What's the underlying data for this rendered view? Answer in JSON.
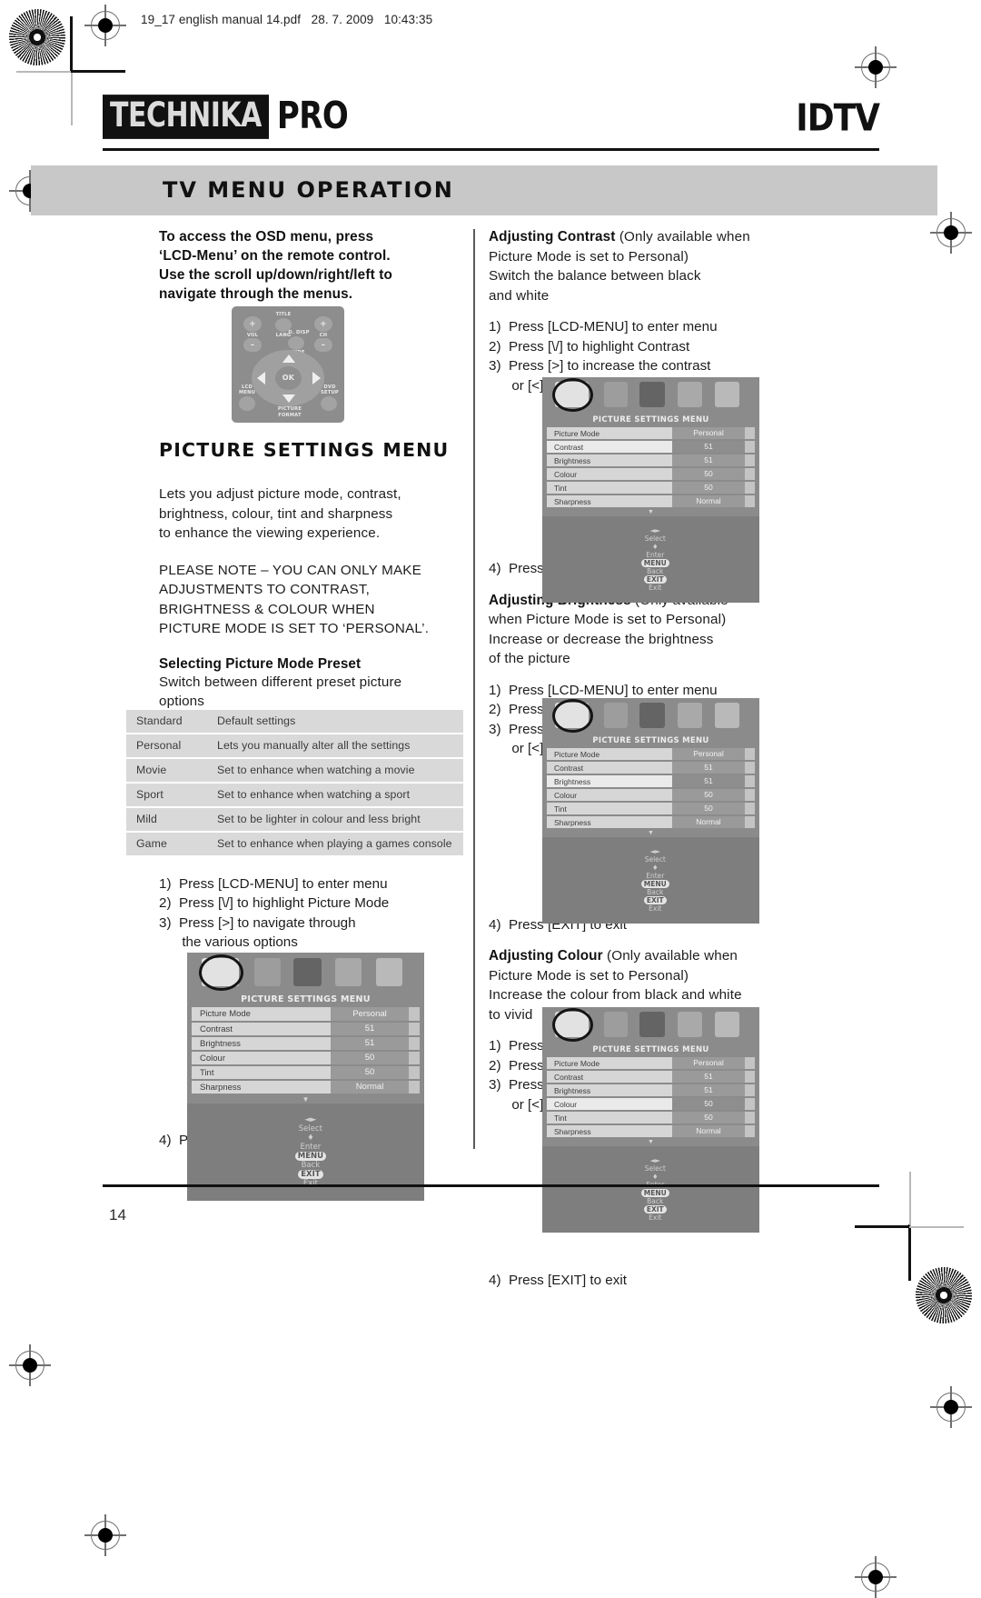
{
  "print": {
    "file_caption": "19_17 english manual 14.pdf   28. 7. 2009   10:43:35"
  },
  "header": {
    "logo_box": "TECHNIKA",
    "logo_pro": "PRO",
    "product": "IDTV",
    "section_title": "TV MENU OPERATION"
  },
  "left_column": {
    "intro": "To access the OSD menu, press ‘LCD-Menu’ on the remote control. Use the scroll up/down/right/left to navigate through the menus.",
    "intro_lines": [
      "To access the OSD menu, press",
      "‘LCD-Menu’ on the remote control.",
      "Use the scroll up/down/right/left to",
      "navigate through the menus."
    ],
    "remote": {
      "labels": {
        "title": "TITLE",
        "lang": "LANG",
        "d_disp": "D. DISP",
        "guide": "GUIDE",
        "vol": "VOL",
        "ch": "CH",
        "ok": "OK",
        "vol_plus": "+",
        "vol_minus": "–",
        "ch_plus": "+",
        "ch_minus": "–",
        "lcd_menu": "LCD\nMENU",
        "dvd_setup": "DVD\nSETUP",
        "picture_format": "PICTURE\nFORMAT"
      }
    },
    "heading": "PICTURE SETTINGS MENU",
    "desc_lines": [
      "Lets you adjust picture mode, contrast,",
      "brightness, colour, tint and sharpness",
      "to enhance the viewing experience."
    ],
    "note_lines": [
      "PLEASE NOTE – YOU CAN ONLY MAKE",
      "ADJUSTMENTS TO CONTRAST,",
      "BRIGHTNESS & COLOUR WHEN",
      "PICTURE MODE IS SET TO ‘PERSONAL’."
    ],
    "preset": {
      "subheading": "Selecting Picture Mode Preset",
      "desc_lines": [
        "Switch between different preset picture",
        "options"
      ],
      "rows": [
        {
          "mode": "Standard",
          "description": "Default settings"
        },
        {
          "mode": "Personal",
          "description": "Lets you manually alter all the settings"
        },
        {
          "mode": "Movie",
          "description": "Set to enhance when watching a movie"
        },
        {
          "mode": "Sport",
          "description": "Set to enhance when watching a sport"
        },
        {
          "mode": "Mild",
          "description": "Set to be lighter in colour and less bright"
        },
        {
          "mode": "Game",
          "description": "Set to enhance when playing a games console"
        }
      ],
      "steps": [
        "1)  Press [LCD-MENU] to enter menu",
        "2)  Press [\\/] to highlight Picture Mode",
        "3)  Press [>] to navigate through",
        "      the various options"
      ],
      "exit_step": "4)  Press [EXIT] to exit"
    }
  },
  "right_column": {
    "contrast": {
      "title": "Adjusting Contrast",
      "title_note": "(Only available when",
      "intro_lines": [
        "Picture Mode is set to Personal)",
        "Switch the balance between black",
        "and white"
      ],
      "steps": [
        "1)  Press [LCD-MENU] to enter menu",
        "2)  Press [\\/] to highlight Contrast",
        "3)  Press [>] to increase the contrast",
        "      or [<] to decrease the contrast"
      ],
      "exit_step": "4)  Press [EXIT] to exit"
    },
    "brightness": {
      "title": "Adjusting Brightness",
      "title_note": "(Only available",
      "intro_lines": [
        "when Picture Mode is set to Personal)",
        "Increase or decrease the brightness",
        "of the picture"
      ],
      "steps": [
        "1)  Press [LCD-MENU] to enter menu",
        "2)  Press [\\/] to highlight Brightness",
        "3)  Press [>] to increase the brightness",
        "      or [<] to decrease the brightness"
      ],
      "exit_step": "4)  Press [EXIT] to exit"
    },
    "colour": {
      "title": "Adjusting Colour",
      "title_note": "(Only available when",
      "intro_lines": [
        "Picture Mode is set to Personal)",
        "Increase the colour from black and white",
        "to vivid"
      ],
      "steps": [
        "1)  Press [LCD-MENU] to enter menu",
        "2)  Press [\\/] to highlight Colour",
        "3)  Press [>] to increase the colour",
        "      or [<] to decrease the colour"
      ],
      "exit_step": "4)  Press [EXIT] to exit"
    }
  },
  "osd": {
    "title": "PICTURE SETTINGS MENU",
    "rows": [
      {
        "label": "Picture Mode",
        "value": "Personal"
      },
      {
        "label": "Contrast",
        "value": "51"
      },
      {
        "label": "Brightness",
        "value": "51"
      },
      {
        "label": "Colour",
        "value": "50"
      },
      {
        "label": "Tint",
        "value": "50"
      },
      {
        "label": "Sharpness",
        "value": "Normal"
      }
    ],
    "caret": "▼",
    "footer": {
      "select": "Select",
      "enter": "Enter",
      "menu_key": "MENU",
      "back": "Back",
      "exit_key": "EXIT",
      "exit": "Exit",
      "lr_arrows": "◄►",
      "down_arrow": "♦"
    },
    "highlight": {
      "left_sample": "Picture Mode",
      "contrast_sample": "Contrast",
      "brightness_sample": "Brightness",
      "colour_sample": "Colour"
    }
  },
  "footer": {
    "page_number": "14"
  },
  "colors": {
    "title_bar": "#c8c8c8",
    "table_row": "#d9d9d9",
    "osd_bg": "#8b8b8b",
    "osd_row": "#d6d6d6",
    "osd_value": "#9a9a9a"
  }
}
